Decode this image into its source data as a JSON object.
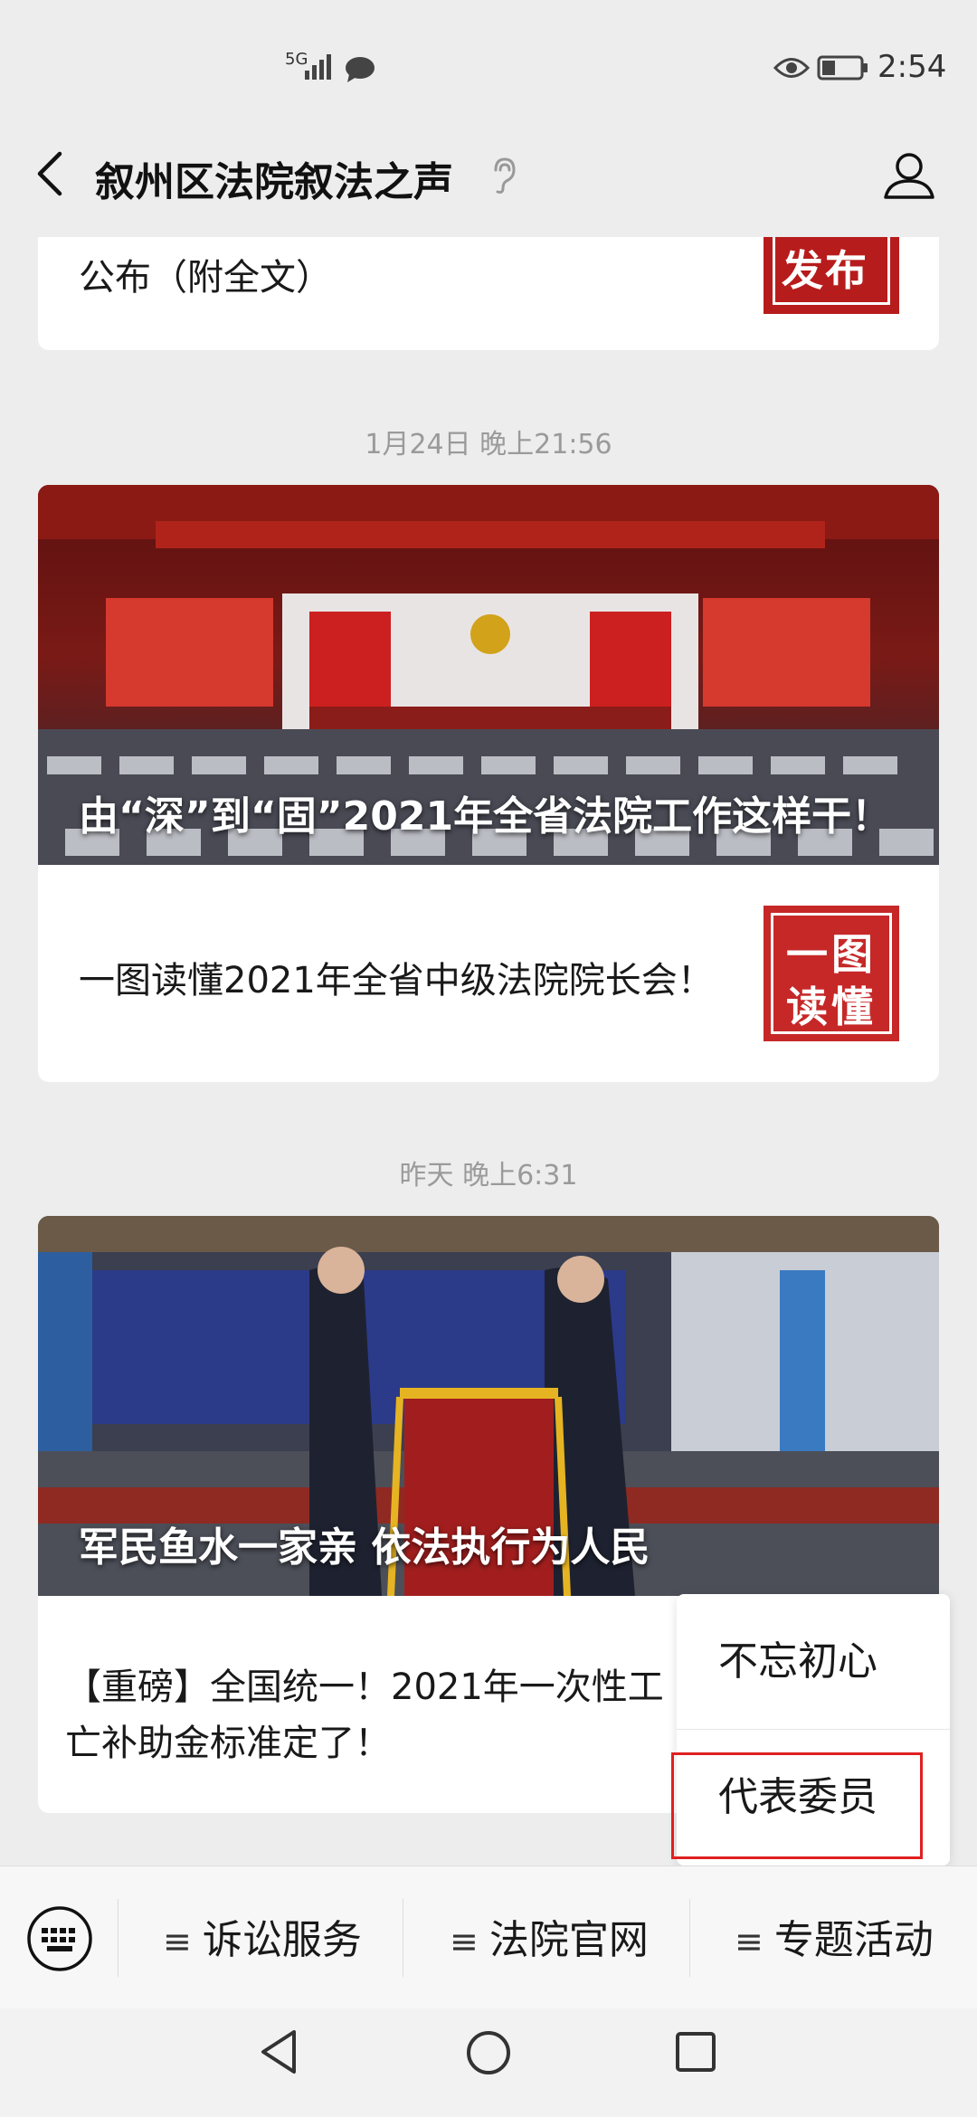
{
  "status_bar": {
    "network": "5G",
    "time": "2:54"
  },
  "nav": {
    "title": "叙州区法院叙法之声"
  },
  "partial_article": {
    "text": "公布（附全文）",
    "thumb_text": "发布"
  },
  "messages": [
    {
      "timestamp": "1月24日 晚上21:56",
      "cover_title": "由“深”到“固”2021年全省法院工作这样干！",
      "sub_text": "一图读懂2021年全省中级法院院长会！",
      "thumb_line1": "一图",
      "thumb_line2": "读懂"
    },
    {
      "timestamp": "昨天 晚上6:31",
      "cover_title": "军民鱼水一家亲  依法执行为人民",
      "sub_text": "【重磅】全国统一！2021年一次性工亡补助金标准定了！"
    }
  ],
  "popup": {
    "items": [
      "不忘初心",
      "代表委员"
    ]
  },
  "menu": {
    "items": [
      "诉讼服务",
      "法院官网",
      "专题活动"
    ]
  },
  "colors": {
    "accent_red": "#c62828",
    "highlight_red": "#e02020",
    "background": "#ededed"
  },
  "icons": [
    "signal-icon",
    "message-icon",
    "eye-icon",
    "battery-icon",
    "back-arrow-icon",
    "ear-icon",
    "profile-icon",
    "keyboard-icon",
    "menu-icon",
    "nav-back-icon",
    "nav-home-icon",
    "nav-recent-icon"
  ]
}
